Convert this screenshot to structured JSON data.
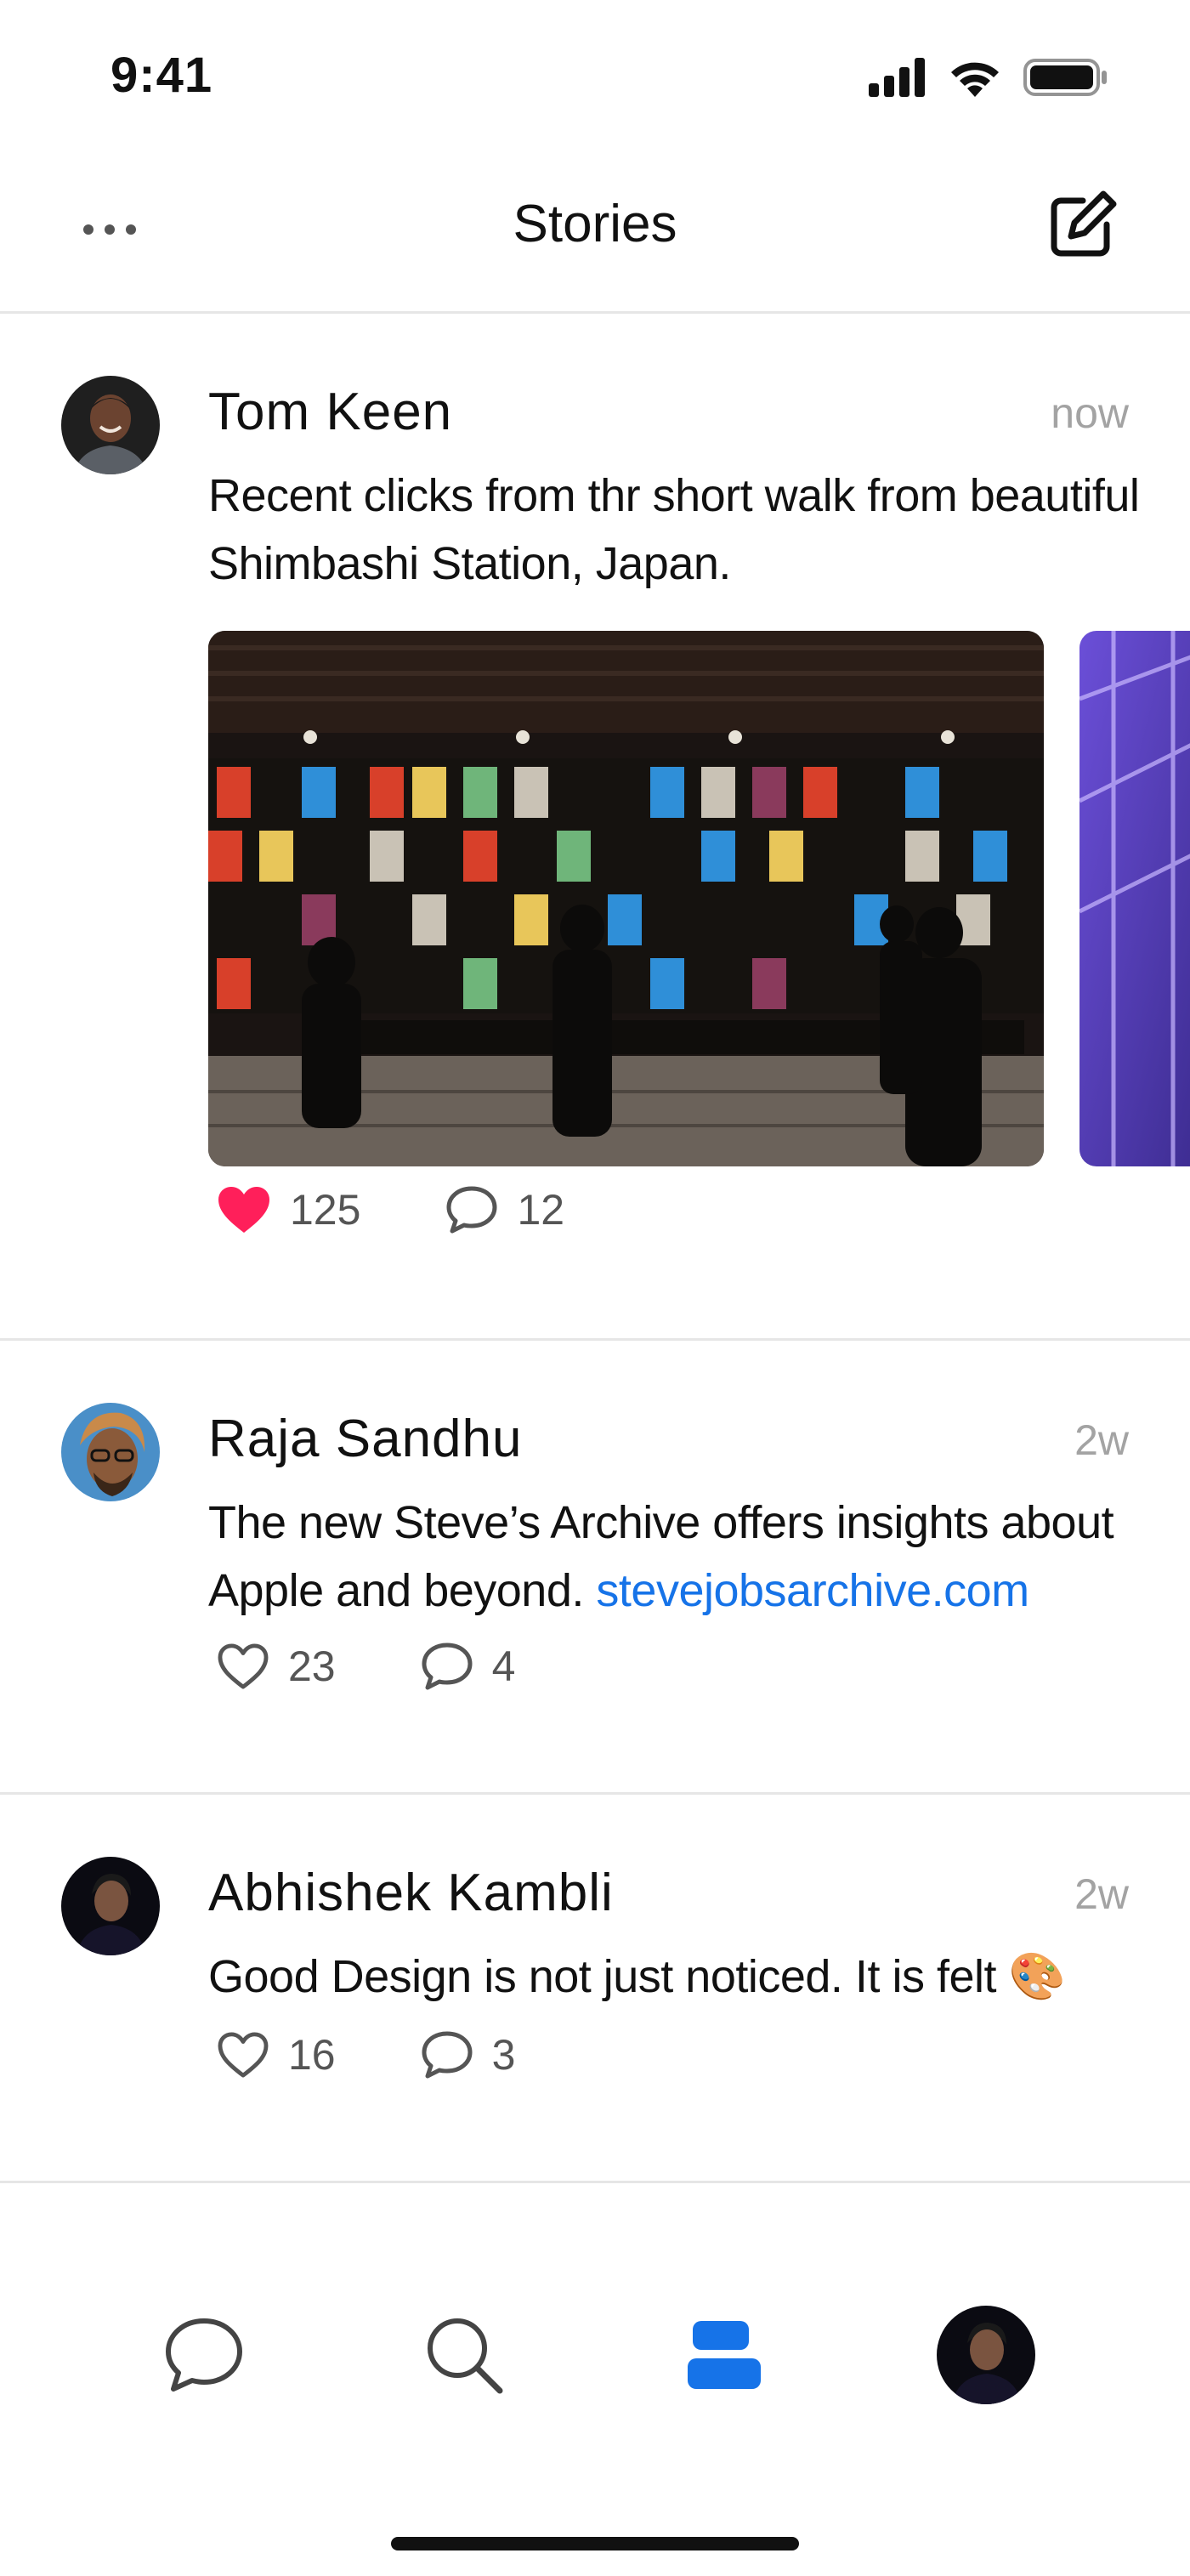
{
  "status_bar": {
    "time": "9:41",
    "icons": [
      "cellular-signal-icon",
      "wifi-icon",
      "battery-icon"
    ]
  },
  "nav": {
    "title": "Stories",
    "left_icon": "more-icon",
    "right_icon": "compose-icon"
  },
  "colors": {
    "accent": "#1673e8",
    "like_active": "#ff1f5a",
    "divider": "#e6e6e6",
    "muted_text": "#a3a3a3"
  },
  "posts": [
    {
      "author": "Tom Keen",
      "time": "now",
      "text": "Recent clicks from thr short walk from beautiful Shimbashi Station, Japan.",
      "photos": [
        "poster-wall-photo",
        "station-interior-photo"
      ],
      "likes": "125",
      "liked": true,
      "comments": "12"
    },
    {
      "author": "Raja Sandhu",
      "time": "2w",
      "text": "The new Steve’s Archive offers insights about Apple and beyond.",
      "link": "stevejobsarchive.com",
      "likes": "23",
      "liked": false,
      "comments": "4"
    },
    {
      "author": "Abhishek Kambli",
      "time": "2w",
      "text": "Good Design is not just noticed. It is felt",
      "emoji": "🎨",
      "likes": "16",
      "liked": false,
      "comments": "3"
    }
  ],
  "tab_bar": {
    "tabs": [
      "chat-icon",
      "search-icon",
      "stories-icon",
      "profile-avatar"
    ],
    "active": "stories-icon"
  }
}
